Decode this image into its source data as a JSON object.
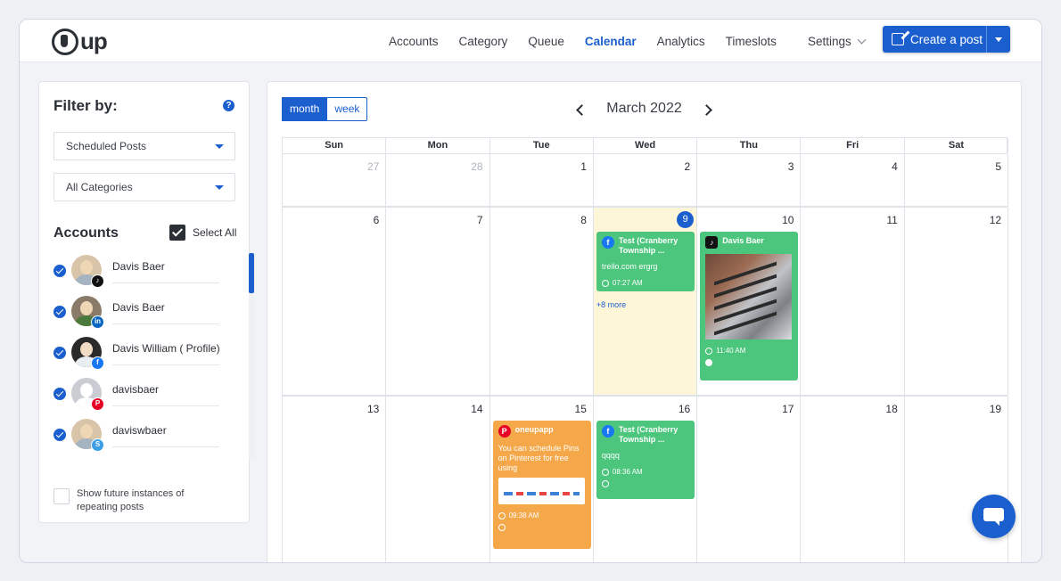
{
  "brand": {
    "logo_text": "up"
  },
  "nav": {
    "items": [
      "Accounts",
      "Category",
      "Queue",
      "Calendar",
      "Analytics",
      "Timeslots"
    ],
    "active": "Calendar",
    "settings_label": "Settings",
    "create_label": "Create a post"
  },
  "filter": {
    "title": "Filter by:",
    "help": "?",
    "post_type": "Scheduled Posts",
    "category": "All Categories",
    "accounts_title": "Accounts",
    "select_all": "Select All",
    "accounts": [
      {
        "name": "Davis Baer",
        "network": "tiktok",
        "badge": "♪",
        "color": "#111111"
      },
      {
        "name": "Davis Baer",
        "network": "linkedin",
        "badge": "in",
        "color": "#0a66c2"
      },
      {
        "name": "Davis William ( Profile)",
        "network": "facebook",
        "badge": "f",
        "color": "#1877f2"
      },
      {
        "name": "davisbaer",
        "network": "pinterest",
        "badge": "P",
        "color": "#e60023"
      },
      {
        "name": "daviswbaer",
        "network": "other",
        "badge": "S",
        "color": "#3b9ee8"
      }
    ],
    "future_label": "Show future instances of repeating posts"
  },
  "calendar": {
    "view_month": "month",
    "view_week": "week",
    "title": "March 2022",
    "weekdays": [
      "Sun",
      "Mon",
      "Tue",
      "Wed",
      "Thu",
      "Fri",
      "Sat"
    ],
    "weeks": [
      [
        "27",
        "28",
        "1",
        "2",
        "3",
        "4",
        "5"
      ],
      [
        "6",
        "7",
        "8",
        "9",
        "10",
        "11",
        "12"
      ],
      [
        "13",
        "14",
        "15",
        "16",
        "17",
        "18",
        "19"
      ]
    ],
    "today": "9",
    "posts": {
      "wed9": {
        "account": "Test (Cranberry Township ...",
        "text": "trello.com ergrg",
        "time": "07:27 AM",
        "more": "+8 more"
      },
      "thu10": {
        "account": "Davis Baer",
        "time": "11:40 AM"
      },
      "tue15": {
        "account": "oneupapp",
        "text": "You can schedule Pins on Pinterest for free using",
        "time": "09:38 AM"
      },
      "wed16": {
        "account": "Test (Cranberry Township ...",
        "text": "qqqq",
        "time": "08:36 AM"
      }
    }
  },
  "colors": {
    "accent": "#1b5fcf",
    "post_green": "#4cc57d",
    "post_orange": "#f5a84a",
    "today_bg": "#fdf6d8"
  }
}
